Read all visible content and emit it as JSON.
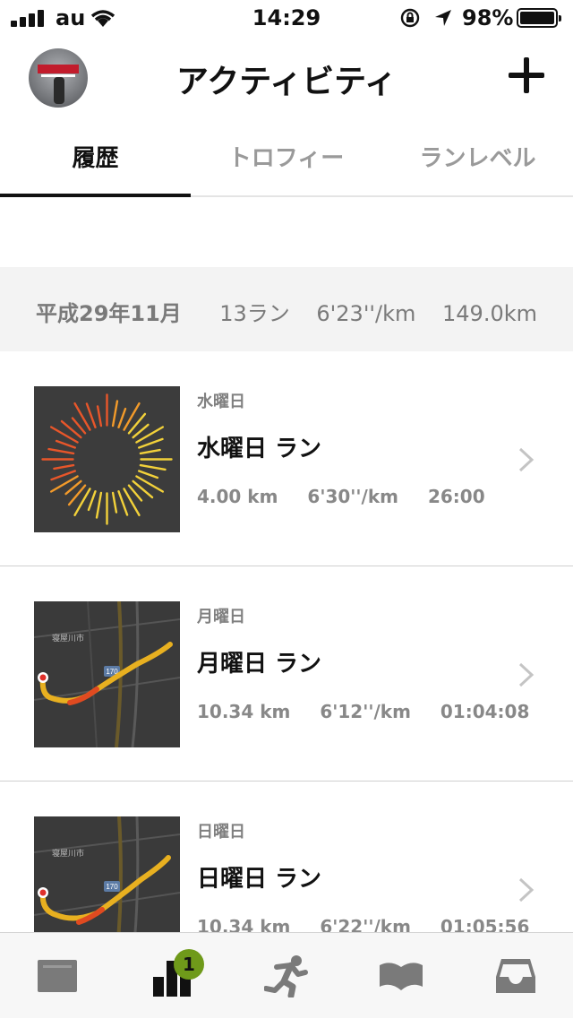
{
  "status_bar": {
    "carrier": "au",
    "time": "14:29",
    "battery_percent": "98%"
  },
  "header": {
    "title": "アクティビティ",
    "add_icon": "plus-icon",
    "avatar_icon": "profile-avatar"
  },
  "tabs": [
    {
      "label": "履歴",
      "active": true
    },
    {
      "label": "トロフィー",
      "active": false
    },
    {
      "label": "ランレベル",
      "active": false
    }
  ],
  "summary": {
    "month": "平成29年11月",
    "runs": "13ラン",
    "pace": "6'23''/km",
    "distance": "149.0km"
  },
  "activities": [
    {
      "day": "水曜日",
      "name": "水曜日 ラン",
      "distance": "4.00 km",
      "pace": "6'30''/km",
      "duration": "26:00",
      "thumb": "sunburst-icon"
    },
    {
      "day": "月曜日",
      "name": "月曜日 ラン",
      "distance": "10.34 km",
      "pace": "6'12''/km",
      "duration": "01:04:08",
      "thumb": "route-map",
      "map_city": "寝屋川市",
      "map_route": "170"
    },
    {
      "day": "日曜日",
      "name": "日曜日 ラン",
      "distance": "10.34 km",
      "pace": "6'22''/km",
      "duration": "01:05:56",
      "thumb": "route-map",
      "map_city": "寝屋川市",
      "map_route": "170"
    }
  ],
  "tabbar": {
    "items": [
      "feed-icon",
      "activity-icon",
      "run-icon",
      "guides-icon",
      "inbox-icon"
    ],
    "badge_count": "1"
  },
  "colors": {
    "accent_badge": "#6f9a1a",
    "route_start": "#e0302a",
    "route_line": "#f5a623"
  }
}
